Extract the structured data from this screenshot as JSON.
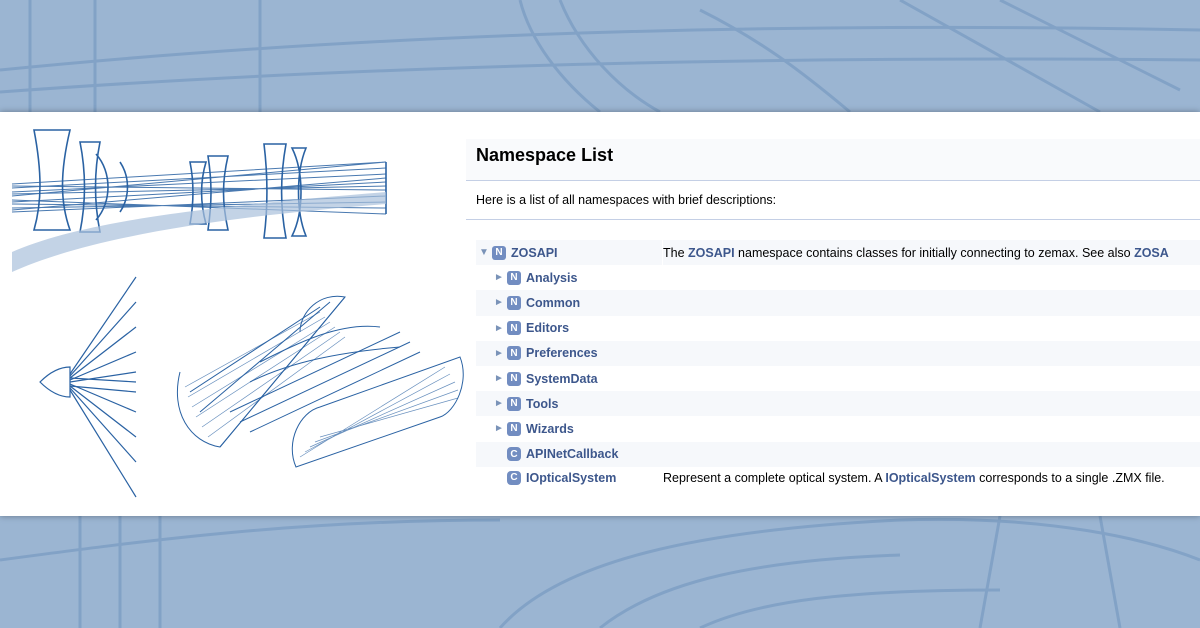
{
  "page": {
    "title": "Namespace List",
    "intro": "Here is a list of all namespaces with brief descriptions:"
  },
  "colors": {
    "background": "#9bb5d2",
    "art_stroke": "#2a62a3",
    "link": "#3d578c",
    "badge": "#728dc1",
    "row_alt": "#f6f8fb"
  },
  "tree": {
    "root": {
      "arrow": "▼",
      "badge": "N",
      "name": "ZOSAPI",
      "desc_pre": "The ",
      "desc_kw1": "ZOSAPI",
      "desc_mid": " namespace contains classes for initially connecting to zemax. See also ",
      "desc_kw2": "ZOSA"
    },
    "children": [
      {
        "arrow": "►",
        "badge": "N",
        "name": "Analysis"
      },
      {
        "arrow": "►",
        "badge": "N",
        "name": "Common"
      },
      {
        "arrow": "►",
        "badge": "N",
        "name": "Editors"
      },
      {
        "arrow": "►",
        "badge": "N",
        "name": "Preferences"
      },
      {
        "arrow": "►",
        "badge": "N",
        "name": "SystemData"
      },
      {
        "arrow": "►",
        "badge": "N",
        "name": "Tools"
      },
      {
        "arrow": "►",
        "badge": "N",
        "name": "Wizards"
      }
    ],
    "classes": [
      {
        "badge": "C",
        "name": "APINetCallback"
      },
      {
        "badge": "C",
        "name": "IOpticalSystem",
        "desc_pre": "Represent a complete optical system. A ",
        "desc_kw": "IOpticalSystem",
        "desc_post": " corresponds to a single .ZMX file."
      }
    ]
  }
}
